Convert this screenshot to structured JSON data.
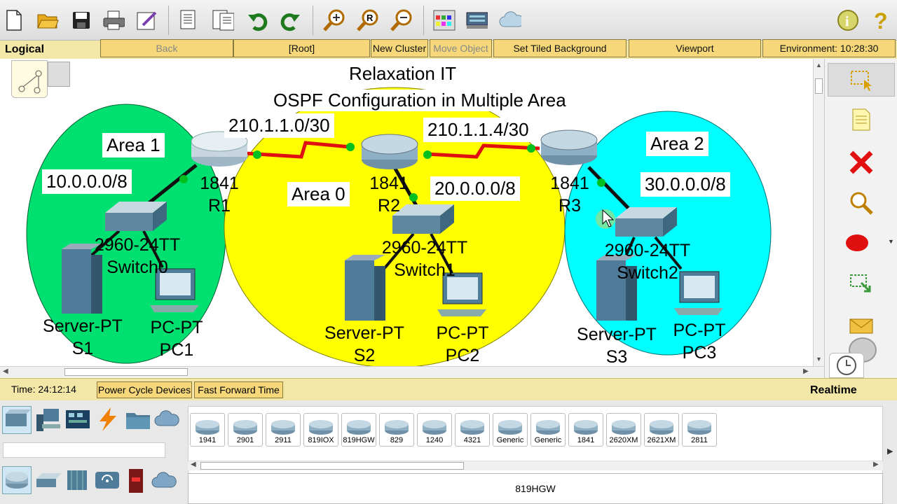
{
  "workspace": {
    "mode_label": "Logical",
    "buttons": {
      "back": "Back",
      "root": "[Root]",
      "new_cluster": "New Cluster",
      "move_object": "Move Object",
      "set_tiled_background": "Set Tiled Background",
      "viewport": "Viewport",
      "environment": "Environment: 10:28:30"
    }
  },
  "diagram": {
    "title": "Relaxation IT",
    "subtitle": "OSPF Configuration in Multiple Area",
    "areas": [
      {
        "name": "Area 1",
        "network": "10.0.0.0/8",
        "color": "#00e070"
      },
      {
        "name": "Area 0",
        "network": "20.0.0.0/8",
        "color": "#ffff00"
      },
      {
        "name": "Area 2",
        "network": "30.0.0.0/8",
        "color": "#00ffff"
      }
    ],
    "links": [
      "210.1.1.0/30",
      "210.1.1.4/30"
    ],
    "routers": [
      {
        "model": "1841",
        "name": "R1"
      },
      {
        "model": "1841",
        "name": "R2"
      },
      {
        "model": "1841",
        "name": "R3"
      }
    ],
    "switches": [
      {
        "model": "2960-24TT",
        "name": "Switch0"
      },
      {
        "model": "2960-24TT",
        "name": "Switch1"
      },
      {
        "model": "2960-24TT",
        "name": "Switch2"
      }
    ],
    "servers": [
      {
        "model": "Server-PT",
        "name": "S1"
      },
      {
        "model": "Server-PT",
        "name": "S2"
      },
      {
        "model": "Server-PT",
        "name": "S3"
      }
    ],
    "pcs": [
      {
        "model": "PC-PT",
        "name": "PC1"
      },
      {
        "model": "PC-PT",
        "name": "PC2"
      },
      {
        "model": "PC-PT",
        "name": "PC3"
      }
    ]
  },
  "status": {
    "time": "Time: 24:12:14",
    "power_cycle": "Power Cycle Devices",
    "fast_forward": "Fast Forward Time",
    "mode": "Realtime"
  },
  "device_list": [
    "1941",
    "2901",
    "2911",
    "819IOX",
    "819HGW",
    "829",
    "1240",
    "4321",
    "Generic",
    "Generic",
    "1841",
    "2620XM",
    "2621XM",
    "2811"
  ],
  "selected_device": "819HGW",
  "toolbar_icons": [
    "new-file-icon",
    "open-folder-icon",
    "save-icon",
    "print-icon",
    "activity-wizard-icon",
    "copy-icon",
    "paste-icon",
    "undo-icon",
    "redo-icon",
    "zoom-in-icon",
    "zoom-reset-icon",
    "zoom-out-icon",
    "palette-icon",
    "custom-device-icon",
    "cloud-icon",
    "info-icon",
    "help-icon"
  ]
}
